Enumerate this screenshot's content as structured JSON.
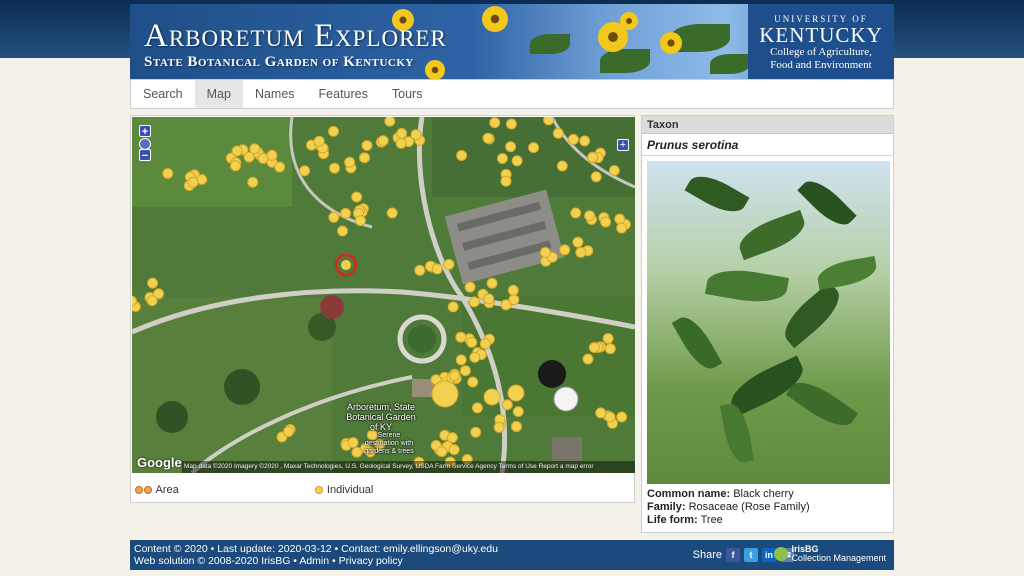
{
  "header": {
    "title": "Arboretum Explorer",
    "subtitle": "State Botanical Garden of Kentucky",
    "university_line1": "UNIVERSITY OF",
    "university_line2": "KENTUCKY",
    "university_line3": "College of Agriculture,",
    "university_line4": "Food and Environment"
  },
  "nav": {
    "tabs": [
      {
        "label": "Search",
        "active": false
      },
      {
        "label": "Map",
        "active": true
      },
      {
        "label": "Names",
        "active": false
      },
      {
        "label": "Features",
        "active": false
      },
      {
        "label": "Tours",
        "active": false
      }
    ]
  },
  "map": {
    "zoom_in": "+",
    "zoom_out": "−",
    "layers": "+",
    "google_mark": "Google",
    "attribution": "Map data ©2020 Imagery ©2020 , Maxar Technologies, U.S. Geological Survey, USDA Farm Service Agency   Terms of Use   Report a map error",
    "place_label": "Arboretum, State Botanical Garden of KY",
    "place_sub": "Serene destination with gardens & trees",
    "colors": {
      "individual": "#f2d150",
      "area": "#e9a55a",
      "selected": "#d9261c"
    }
  },
  "legend": {
    "area_label": "Area",
    "individual_label": "Individual"
  },
  "taxon": {
    "heading": "Taxon",
    "name": "Prunus serotina",
    "common_name_label": "Common name:",
    "common_name": "Black cherry",
    "family_label": "Family:",
    "family": "Rosaceae (Rose Family)",
    "life_form_label": "Life form:",
    "life_form": "Tree"
  },
  "footer": {
    "line1": "Content © 2020 • Last update: 2020-03-12 • Contact: emily.ellingson@uky.edu",
    "web_solution": "Web solution © 2008-2020 IrisBG •",
    "admin": "Admin",
    "sep": "•",
    "privacy": "Privacy policy",
    "share_label": "Share",
    "social": [
      "f",
      "t",
      "in",
      "✉"
    ],
    "irisbg_name": "IrisBG",
    "irisbg_tag": "Collection Management"
  }
}
